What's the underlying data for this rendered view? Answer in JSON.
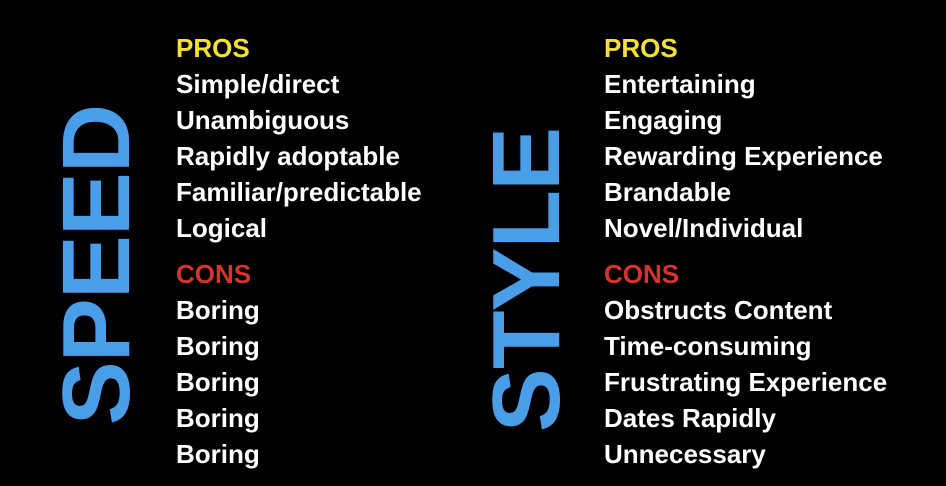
{
  "colors": {
    "background": "#000000",
    "vertical_word": "#4A9DE8",
    "pros_header": "#F5E133",
    "cons_header": "#D8332A",
    "item_text": "#FFFFFF"
  },
  "left": {
    "vertical_word": "SPEED",
    "pros_title": "PROS",
    "pros": [
      "Simple/direct",
      "Unambiguous",
      "Rapidly adoptable",
      "Familiar/predictable",
      "Logical"
    ],
    "cons_title": "CONS",
    "cons": [
      "Boring",
      "Boring",
      "Boring",
      "Boring",
      "Boring"
    ]
  },
  "right": {
    "vertical_word": "STYLE",
    "pros_title": "PROS",
    "pros": [
      "Entertaining",
      "Engaging",
      "Rewarding Experience",
      "Brandable",
      "Novel/Individual"
    ],
    "cons_title": "CONS",
    "cons": [
      "Obstructs Content",
      "Time-consuming",
      "Frustrating Experience",
      "Dates Rapidly",
      "Unnecessary"
    ]
  }
}
